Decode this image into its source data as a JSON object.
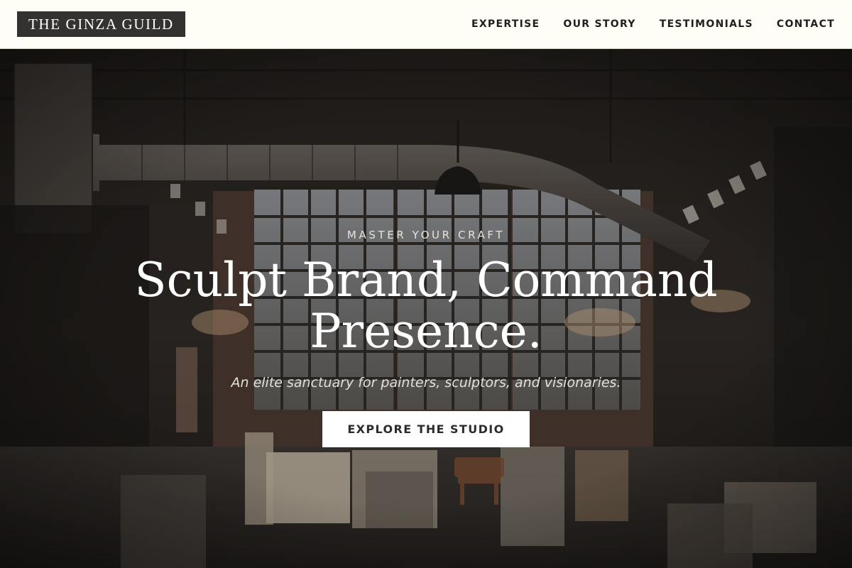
{
  "header": {
    "logo_text": "THE GINZA GUILD",
    "nav": [
      {
        "label": "EXPERTISE"
      },
      {
        "label": "OUR STORY"
      },
      {
        "label": "TESTIMONIALS"
      },
      {
        "label": "CONTACT"
      }
    ]
  },
  "hero": {
    "eyebrow": "MASTER YOUR CRAFT",
    "headline": "Sculpt Brand, Command Presence.",
    "subline": "An elite sanctuary for painters, sculptors, and visionaries.",
    "cta_label": "EXPLORE THE STUDIO"
  },
  "colors": {
    "header_bg": "#fefef6",
    "logo_bg": "#333231",
    "cta_bg": "#ffffff",
    "cta_text": "#2b2b2b"
  }
}
